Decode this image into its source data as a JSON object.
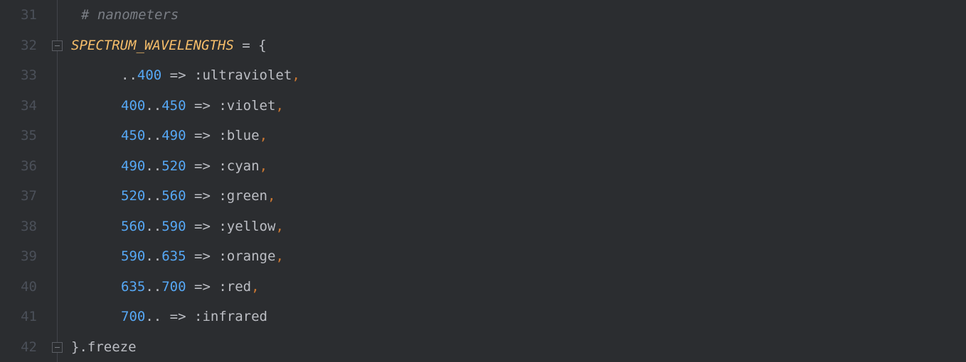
{
  "gutter": {
    "lines": [
      "31",
      "32",
      "33",
      "34",
      "35",
      "36",
      "37",
      "38",
      "39",
      "40",
      "41",
      "42"
    ]
  },
  "fold": {
    "open_row": 1,
    "close_row": 11
  },
  "code": {
    "rows": [
      {
        "type": "comment",
        "indent": 1,
        "tokens": [
          {
            "cls": "c-comment",
            "t": "# nanometers"
          }
        ]
      },
      {
        "type": "decl",
        "indent": 0,
        "tokens": [
          {
            "cls": "c-const",
            "t": "SPECTRUM_WAVELENGTHS"
          },
          {
            "cls": "c-default",
            "t": " "
          },
          {
            "cls": "c-op",
            "t": "="
          },
          {
            "cls": "c-default",
            "t": " "
          },
          {
            "cls": "c-brace",
            "t": "{"
          }
        ]
      },
      {
        "type": "entry",
        "indent": 2,
        "tokens": [
          {
            "cls": "c-op",
            "t": ".."
          },
          {
            "cls": "c-num",
            "t": "400"
          },
          {
            "cls": "c-default",
            "t": " "
          },
          {
            "cls": "c-op",
            "t": "=>"
          },
          {
            "cls": "c-default",
            "t": " "
          },
          {
            "cls": "c-symcolon",
            "t": ":"
          },
          {
            "cls": "c-sym",
            "t": "ultraviolet"
          },
          {
            "cls": "c-comma",
            "t": ","
          }
        ]
      },
      {
        "type": "entry",
        "indent": 2,
        "tokens": [
          {
            "cls": "c-num",
            "t": "400"
          },
          {
            "cls": "c-op",
            "t": ".."
          },
          {
            "cls": "c-num",
            "t": "450"
          },
          {
            "cls": "c-default",
            "t": " "
          },
          {
            "cls": "c-op",
            "t": "=>"
          },
          {
            "cls": "c-default",
            "t": " "
          },
          {
            "cls": "c-symcolon",
            "t": ":"
          },
          {
            "cls": "c-sym",
            "t": "violet"
          },
          {
            "cls": "c-comma",
            "t": ","
          }
        ]
      },
      {
        "type": "entry",
        "indent": 2,
        "tokens": [
          {
            "cls": "c-num",
            "t": "450"
          },
          {
            "cls": "c-op",
            "t": ".."
          },
          {
            "cls": "c-num",
            "t": "490"
          },
          {
            "cls": "c-default",
            "t": " "
          },
          {
            "cls": "c-op",
            "t": "=>"
          },
          {
            "cls": "c-default",
            "t": " "
          },
          {
            "cls": "c-symcolon",
            "t": ":"
          },
          {
            "cls": "c-sym",
            "t": "blue"
          },
          {
            "cls": "c-comma",
            "t": ","
          }
        ]
      },
      {
        "type": "entry",
        "indent": 2,
        "tokens": [
          {
            "cls": "c-num",
            "t": "490"
          },
          {
            "cls": "c-op",
            "t": ".."
          },
          {
            "cls": "c-num",
            "t": "520"
          },
          {
            "cls": "c-default",
            "t": " "
          },
          {
            "cls": "c-op",
            "t": "=>"
          },
          {
            "cls": "c-default",
            "t": " "
          },
          {
            "cls": "c-symcolon",
            "t": ":"
          },
          {
            "cls": "c-sym",
            "t": "cyan"
          },
          {
            "cls": "c-comma",
            "t": ","
          }
        ]
      },
      {
        "type": "entry",
        "indent": 2,
        "tokens": [
          {
            "cls": "c-num",
            "t": "520"
          },
          {
            "cls": "c-op",
            "t": ".."
          },
          {
            "cls": "c-num",
            "t": "560"
          },
          {
            "cls": "c-default",
            "t": " "
          },
          {
            "cls": "c-op",
            "t": "=>"
          },
          {
            "cls": "c-default",
            "t": " "
          },
          {
            "cls": "c-symcolon",
            "t": ":"
          },
          {
            "cls": "c-sym",
            "t": "green"
          },
          {
            "cls": "c-comma",
            "t": ","
          }
        ]
      },
      {
        "type": "entry",
        "indent": 2,
        "tokens": [
          {
            "cls": "c-num",
            "t": "560"
          },
          {
            "cls": "c-op",
            "t": ".."
          },
          {
            "cls": "c-num",
            "t": "590"
          },
          {
            "cls": "c-default",
            "t": " "
          },
          {
            "cls": "c-op",
            "t": "=>"
          },
          {
            "cls": "c-default",
            "t": " "
          },
          {
            "cls": "c-symcolon",
            "t": ":"
          },
          {
            "cls": "c-sym",
            "t": "yellow"
          },
          {
            "cls": "c-comma",
            "t": ","
          }
        ]
      },
      {
        "type": "entry",
        "indent": 2,
        "tokens": [
          {
            "cls": "c-num",
            "t": "590"
          },
          {
            "cls": "c-op",
            "t": ".."
          },
          {
            "cls": "c-num",
            "t": "635"
          },
          {
            "cls": "c-default",
            "t": " "
          },
          {
            "cls": "c-op",
            "t": "=>"
          },
          {
            "cls": "c-default",
            "t": " "
          },
          {
            "cls": "c-symcolon",
            "t": ":"
          },
          {
            "cls": "c-sym",
            "t": "orange"
          },
          {
            "cls": "c-comma",
            "t": ","
          }
        ]
      },
      {
        "type": "entry",
        "indent": 2,
        "tokens": [
          {
            "cls": "c-num",
            "t": "635"
          },
          {
            "cls": "c-op",
            "t": ".."
          },
          {
            "cls": "c-num",
            "t": "700"
          },
          {
            "cls": "c-default",
            "t": " "
          },
          {
            "cls": "c-op",
            "t": "=>"
          },
          {
            "cls": "c-default",
            "t": " "
          },
          {
            "cls": "c-symcolon",
            "t": ":"
          },
          {
            "cls": "c-sym",
            "t": "red"
          },
          {
            "cls": "c-comma",
            "t": ","
          }
        ]
      },
      {
        "type": "entry",
        "indent": 2,
        "tokens": [
          {
            "cls": "c-num",
            "t": "700"
          },
          {
            "cls": "c-op",
            "t": ".."
          },
          {
            "cls": "c-default",
            "t": " "
          },
          {
            "cls": "c-op",
            "t": "=>"
          },
          {
            "cls": "c-default",
            "t": " "
          },
          {
            "cls": "c-symcolon",
            "t": ":"
          },
          {
            "cls": "c-sym",
            "t": "infrared"
          }
        ]
      },
      {
        "type": "close",
        "indent": 0,
        "tokens": [
          {
            "cls": "c-brace",
            "t": "}"
          },
          {
            "cls": "c-default",
            "t": ".freeze"
          }
        ]
      }
    ]
  }
}
